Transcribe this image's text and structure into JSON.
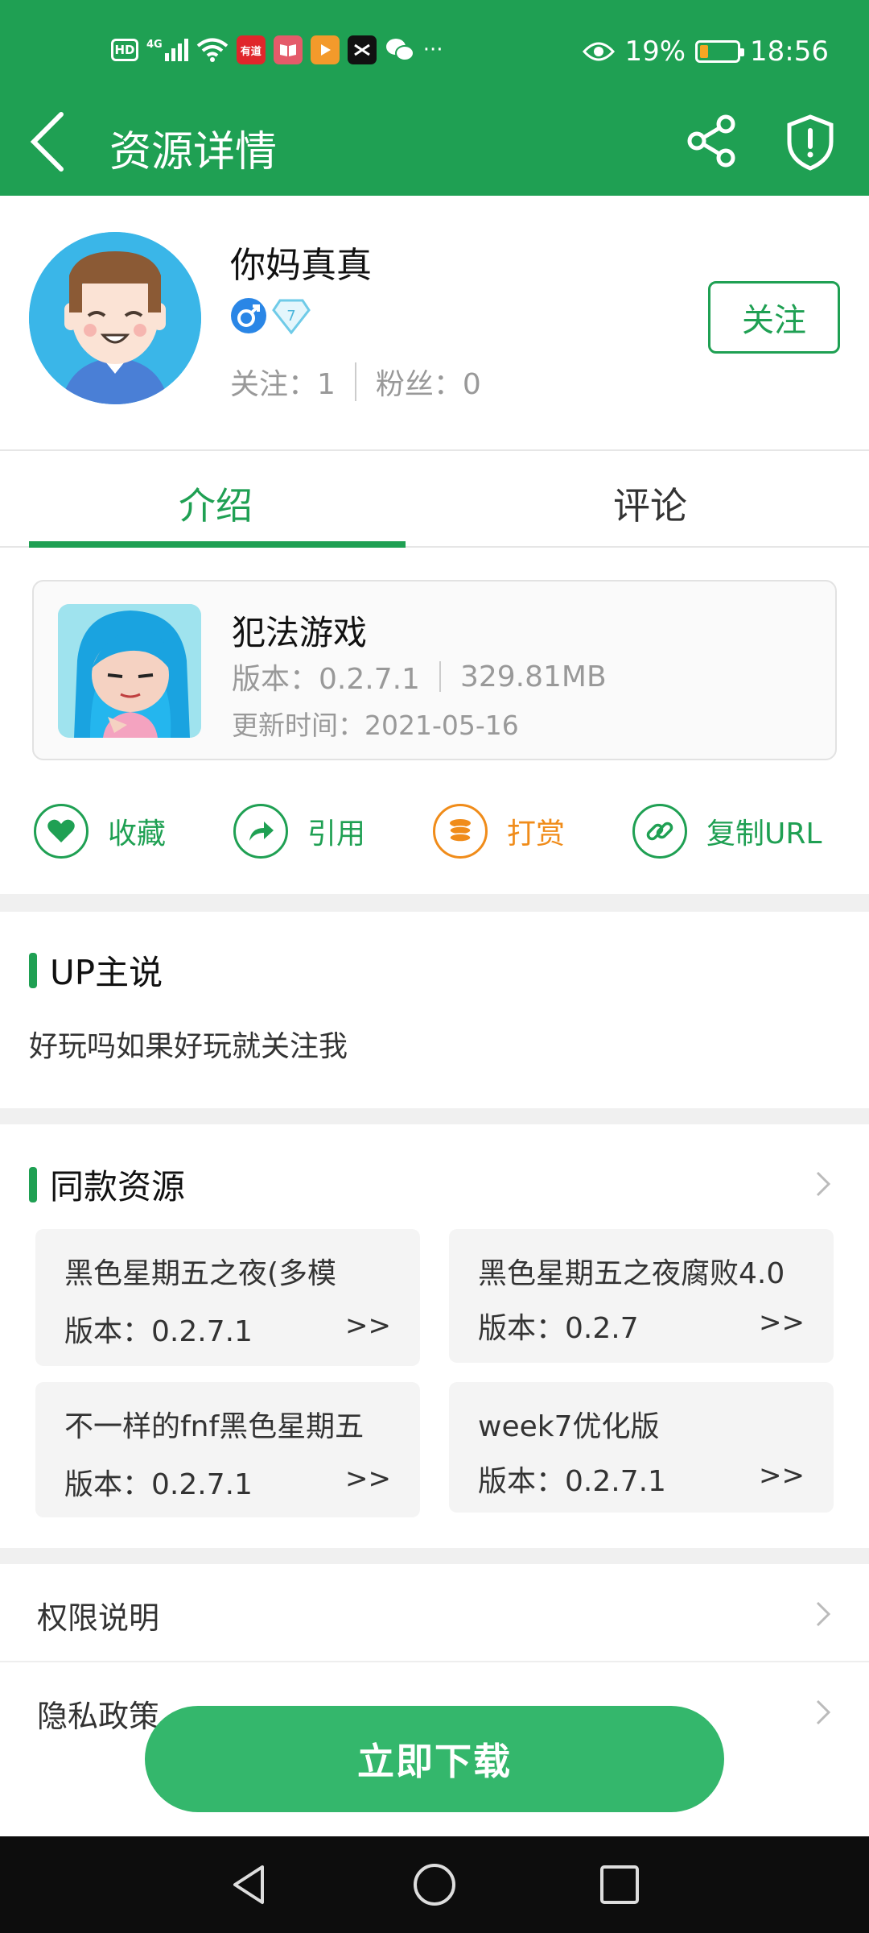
{
  "status_bar": {
    "network": "4G",
    "hd": "HD",
    "app_badge_1": "有道",
    "more": "···",
    "battery_percent": "19%",
    "battery_level": 0.19,
    "time": "18:56"
  },
  "header": {
    "title": "资源详情",
    "background": "#1fa053"
  },
  "author": {
    "name": "你妈真真",
    "level": "7",
    "following_label": "关注：1",
    "followers_label": "粉丝：0",
    "follow_button": "关注"
  },
  "tabs": [
    {
      "label": "介绍",
      "active": true
    },
    {
      "label": "评论",
      "active": false
    }
  ],
  "resource": {
    "name": "犯法游戏",
    "version": "版本：0.2.7.1",
    "size": "329.81MB",
    "updated": "更新时间：2021-05-16"
  },
  "actions": [
    {
      "label": "收藏",
      "icon": "heart-icon",
      "color": "#1fa053"
    },
    {
      "label": "引用",
      "icon": "share-arrow-icon",
      "color": "#1fa053"
    },
    {
      "label": "打赏",
      "icon": "coins-icon",
      "color": "#f08c1a"
    },
    {
      "label": "复制URL",
      "icon": "link-icon",
      "color": "#1fa053"
    }
  ],
  "up_says": {
    "title": "UP主说",
    "text": "好玩吗如果好玩就关注我"
  },
  "similar": {
    "title": "同款资源",
    "items": [
      {
        "name": "黑色星期五之夜(多模",
        "version": "版本：0.2.7.1",
        "arrow": ">>"
      },
      {
        "name": "黑色星期五之夜腐败4.0",
        "version": "版本：0.2.7",
        "arrow": ">>"
      },
      {
        "name": "不一样的fnf黑色星期五",
        "version": "版本：0.2.7.1",
        "arrow": ">>"
      },
      {
        "name": "week7优化版",
        "version": "版本：0.2.7.1",
        "arrow": ">>"
      }
    ]
  },
  "links": {
    "permissions": "权限说明",
    "privacy": "隐私政策"
  },
  "download_button": "立即下载"
}
